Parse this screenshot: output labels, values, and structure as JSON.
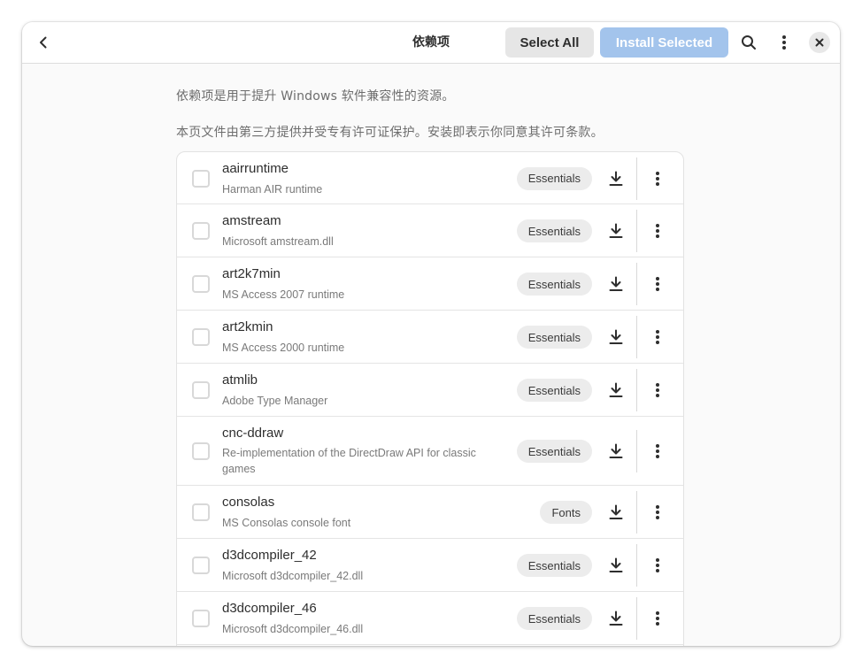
{
  "header": {
    "title": "依赖项",
    "select_all_label": "Select All",
    "install_selected_label": "Install Selected",
    "icons": [
      "back-icon",
      "search-icon",
      "more-vertical-icon",
      "close-icon"
    ]
  },
  "intro": {
    "line1": "依赖项是用于提升 Windows 软件兼容性的资源。",
    "line2": "本页文件由第三方提供并受专有许可证保护。安装即表示你同意其许可条款。"
  },
  "dependencies": [
    {
      "name": "aairruntime",
      "description": "Harman AIR runtime",
      "category": "Essentials"
    },
    {
      "name": "amstream",
      "description": "Microsoft amstream.dll",
      "category": "Essentials"
    },
    {
      "name": "art2k7min",
      "description": "MS Access 2007 runtime",
      "category": "Essentials"
    },
    {
      "name": "art2kmin",
      "description": "MS Access 2000 runtime",
      "category": "Essentials"
    },
    {
      "name": "atmlib",
      "description": "Adobe Type Manager",
      "category": "Essentials"
    },
    {
      "name": "cnc-ddraw",
      "description": "Re-implementation of the DirectDraw API for classic games",
      "category": "Essentials"
    },
    {
      "name": "consolas",
      "description": "MS Consolas console font",
      "category": "Fonts"
    },
    {
      "name": "d3dcompiler_42",
      "description": "Microsoft d3dcompiler_42.dll",
      "category": "Essentials"
    },
    {
      "name": "d3dcompiler_46",
      "description": "Microsoft d3dcompiler_46.dll",
      "category": "Essentials"
    }
  ],
  "colors": {
    "accent_disabled": "#a3c4ec",
    "button_neutral": "#e6e6e6",
    "badge_bg": "#ececec"
  }
}
